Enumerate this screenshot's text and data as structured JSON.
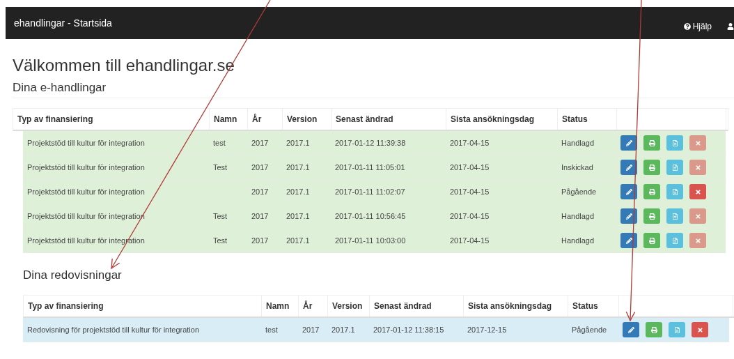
{
  "navbar": {
    "title": "ehandlingar - Startsida",
    "help": "Hjälp"
  },
  "heading": "Välkommen till ehandlingar.se",
  "sections": [
    {
      "title": "Dina e-handlingar",
      "kind": "success",
      "columns": [
        "Typ av finansiering",
        "Namn",
        "År",
        "Version",
        "Senast ändrad",
        "Sista ansökningsdag",
        "Status"
      ],
      "rows": [
        {
          "cells": [
            "Projektstöd till kultur för integration",
            "test",
            "2017",
            "2017.1",
            "2017-01-12 11:39:38",
            "2017-04-15",
            "Handlagd"
          ],
          "delete_disabled": true
        },
        {
          "cells": [
            "Projektstöd till kultur för integration",
            "Test",
            "2017",
            "2017.1",
            "2017-01-11 11:05:01",
            "2017-04-15",
            "Inskickad"
          ],
          "delete_disabled": true
        },
        {
          "cells": [
            "Projektstöd till kultur för integration",
            "",
            "2017",
            "2017.1",
            "2017-01-11 11:02:07",
            "2017-04-15",
            "Pågående"
          ],
          "delete_disabled": false
        },
        {
          "cells": [
            "Projektstöd till kultur för integration",
            "Test",
            "2017",
            "2017.1",
            "2017-01-11 10:56:45",
            "2017-04-15",
            "Handlagd"
          ],
          "delete_disabled": true
        },
        {
          "cells": [
            "Projektstöd till kultur för integration",
            "Test",
            "2017",
            "2017.1",
            "2017-01-11 10:03:00",
            "2017-04-15",
            "Handlagd"
          ],
          "delete_disabled": true
        }
      ]
    },
    {
      "title": "Dina redovisningar",
      "kind": "info",
      "columns": [
        "Typ av finansiering",
        "Namn",
        "År",
        "Version",
        "Senast ändrad",
        "Sista ansökningsdag",
        "Status"
      ],
      "rows": [
        {
          "cells": [
            "Redovisning för projektstöd till kultur för integration",
            "test",
            "2017",
            "2017.1",
            "2017-01-12 11:38:15",
            "2017-12-15",
            "Pågående"
          ],
          "delete_disabled": false
        }
      ]
    }
  ]
}
